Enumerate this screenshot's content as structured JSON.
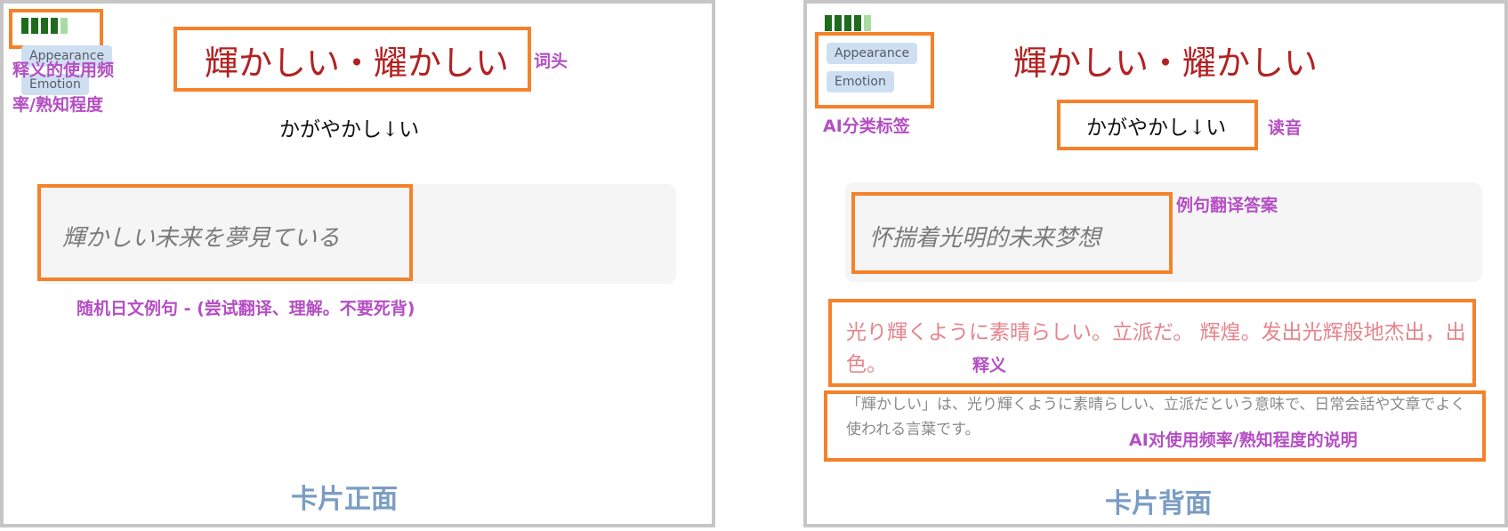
{
  "front": {
    "frequency_level": 4,
    "frequency_max": 5,
    "tags": [
      "Appearance",
      "Emotion"
    ],
    "headword": "輝かしい・耀かしい",
    "reading": "かがやかし↓い",
    "sentence": "輝かしい未来を夢見ている",
    "annotations": {
      "freq_line1": "释义的使用频",
      "freq_line2": "率/熟知程度",
      "headword": "词头",
      "sentence": "随机日文例句 - (尝试翻译、理解。不要死背)"
    },
    "side_label": "卡片正面"
  },
  "back": {
    "frequency_level": 4,
    "frequency_max": 5,
    "tags": [
      "Appearance",
      "Emotion"
    ],
    "headword": "輝かしい・耀かしい",
    "reading": "かがやかし↓い",
    "translation": "怀揣着光明的未来梦想",
    "definition": "光り輝くように素晴らしい。立派だ。 辉煌。发出光辉般地杰出，出色。",
    "frequency_note": "「輝かしい」は、光り輝くように素晴らしい、立派だという意味で、日常会話や文章でよく使われる言葉です。",
    "annotations": {
      "tags": "AI分类标签",
      "reading": "读音",
      "translation": "例句翻译答案",
      "definition": "释义",
      "frequency_note": "AI对使用频率/熟知程度的说明"
    },
    "side_label": "卡片背面"
  },
  "colors": {
    "highlight_box": "#f5822a",
    "annotation_text": "#b44fc3",
    "side_label": "#7b9dc4",
    "headword": "#b22222",
    "definition": "#e5848c",
    "freq_bar_filled": "#1e6b1e",
    "freq_bar_empty": "#a9dca3",
    "tag_bg": "#cfdff2"
  }
}
